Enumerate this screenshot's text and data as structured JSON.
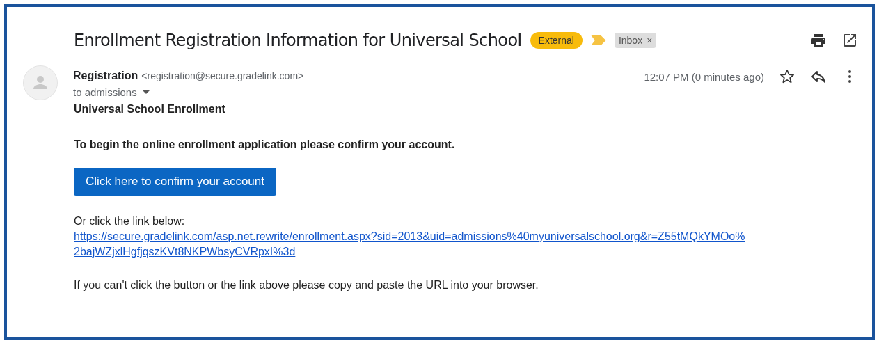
{
  "subject": "Enrollment Registration Information for Universal School",
  "labels": [
    {
      "kind": "external",
      "text": "External"
    },
    {
      "kind": "importance"
    },
    {
      "kind": "folder",
      "text": "Inbox",
      "close": "×"
    }
  ],
  "sender": {
    "name": "Registration",
    "email": "<registration@secure.gradelink.com>",
    "to": "to admissions",
    "time": "12:07 PM (0 minutes ago)",
    "starred": false
  },
  "body": {
    "heading": "Universal School Enrollment",
    "intro": "To begin the online enrollment application please confirm your account.",
    "button": "Click here to confirm your account",
    "or_text": "Or click the link below:",
    "link_lines": [
      "https://secure.gradelink.com/asp.net.rewrite/enrollment.aspx?sid=2013&uid=admissions%40myuniversalschool.org&r=Z55tMQkYMOo%",
      "2bajWZjxlHgfjqszKVt8NKPWbsyCVRpxI%3d"
    ],
    "footer": "If you can't click the button or the link above please copy and paste the URL into your browser."
  }
}
